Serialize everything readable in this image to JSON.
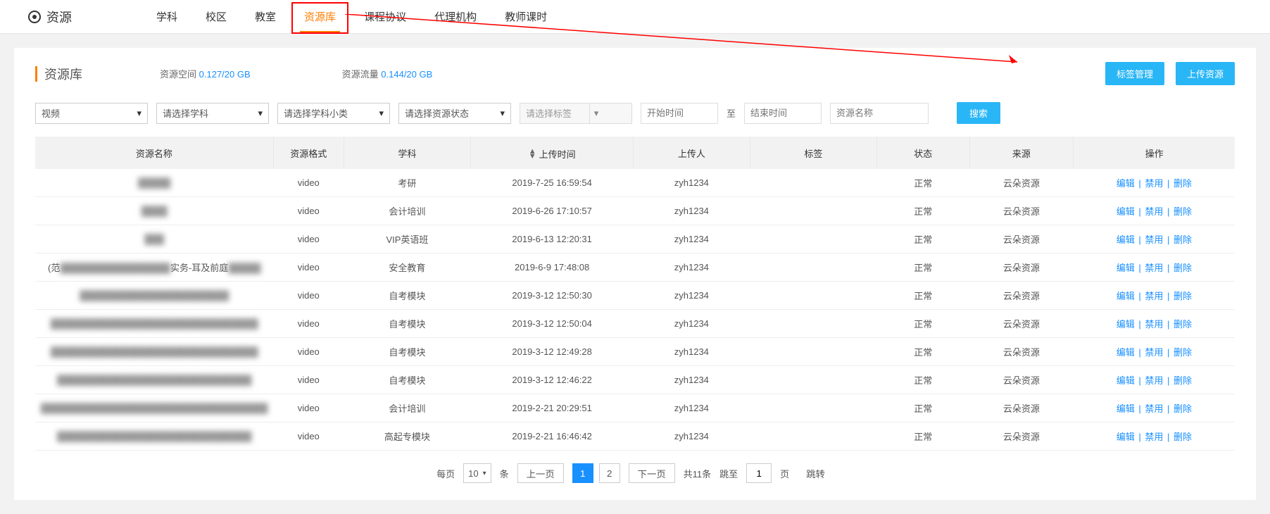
{
  "topNav": {
    "title": "资源",
    "tabs": [
      "学科",
      "校区",
      "教室",
      "资源库",
      "课程协议",
      "代理机构",
      "教师课时"
    ],
    "activeIndex": 3
  },
  "page": {
    "title": "资源库",
    "stats": {
      "spaceLabel": "资源空间",
      "spaceValue": "0.127/20 GB",
      "trafficLabel": "资源流量",
      "trafficValue": "0.144/20 GB"
    },
    "actions": {
      "tagManage": "标签管理",
      "upload": "上传资源"
    }
  },
  "filters": {
    "type": "视频",
    "subject": "请选择学科",
    "subcat": "请选择学科小类",
    "status": "请选择资源状态",
    "tag": "请选择标签",
    "startPlaceholder": "开始时间",
    "to": "至",
    "endPlaceholder": "结束时间",
    "namePlaceholder": "资源名称",
    "search": "搜索"
  },
  "table": {
    "headers": [
      "资源名称",
      "资源格式",
      "学科",
      "上传时间",
      "上传人",
      "标签",
      "状态",
      "来源",
      "操作"
    ],
    "sortCol": 3,
    "rows": [
      {
        "name": "█████",
        "blurred": true,
        "format": "video",
        "subject": "考研",
        "time": "2019-7-25 16:59:54",
        "uploader": "zyh1234",
        "tag": "",
        "status": "正常",
        "source": "云朵资源"
      },
      {
        "name": "████",
        "blurred": true,
        "format": "video",
        "subject": "会计培训",
        "time": "2019-6-26 17:10:57",
        "uploader": "zyh1234",
        "tag": "",
        "status": "正常",
        "source": "云朵资源"
      },
      {
        "name": "███",
        "blurred": true,
        "format": "video",
        "subject": "VIP英语班",
        "time": "2019-6-13 12:20:31",
        "uploader": "zyh1234",
        "tag": "",
        "status": "正常",
        "source": "云朵资源"
      },
      {
        "name": "(范█████████████████实务-耳及前庭█████",
        "blurred": false,
        "partialBlur": true,
        "format": "video",
        "subject": "安全教育",
        "time": "2019-6-9 17:48:08",
        "uploader": "zyh1234",
        "tag": "",
        "status": "正常",
        "source": "云朵资源"
      },
      {
        "name": "███████████████████████",
        "blurred": true,
        "format": "video",
        "subject": "自考模块",
        "time": "2019-3-12 12:50:30",
        "uploader": "zyh1234",
        "tag": "",
        "status": "正常",
        "source": "云朵资源"
      },
      {
        "name": "████████████████████████████████",
        "blurred": true,
        "format": "video",
        "subject": "自考模块",
        "time": "2019-3-12 12:50:04",
        "uploader": "zyh1234",
        "tag": "",
        "status": "正常",
        "source": "云朵资源"
      },
      {
        "name": "████████████████████████████████",
        "blurred": true,
        "format": "video",
        "subject": "自考模块",
        "time": "2019-3-12 12:49:28",
        "uploader": "zyh1234",
        "tag": "",
        "status": "正常",
        "source": "云朵资源"
      },
      {
        "name": "██████████████████████████████",
        "blurred": true,
        "format": "video",
        "subject": "自考模块",
        "time": "2019-3-12 12:46:22",
        "uploader": "zyh1234",
        "tag": "",
        "status": "正常",
        "source": "云朵资源"
      },
      {
        "name": "███████████████████████████████████",
        "blurred": true,
        "format": "video",
        "subject": "会计培训",
        "time": "2019-2-21 20:29:51",
        "uploader": "zyh1234",
        "tag": "",
        "status": "正常",
        "source": "云朵资源"
      },
      {
        "name": "██████████████████████████████",
        "blurred": true,
        "format": "video",
        "subject": "高起专模块",
        "time": "2019-2-21 16:46:42",
        "uploader": "zyh1234",
        "tag": "",
        "status": "正常",
        "source": "云朵资源"
      }
    ],
    "actions": {
      "edit": "编辑",
      "disable": "禁用",
      "delete": "删除"
    }
  },
  "pagination": {
    "perPageLabel": "每页",
    "perPageValue": "10",
    "perPageUnit": "条",
    "prev": "上一页",
    "pages": [
      "1",
      "2"
    ],
    "activePage": 0,
    "next": "下一页",
    "totalLabel": "共11条",
    "jumpLabel": "跳至",
    "jumpValue": "1",
    "jumpUnit": "页",
    "jumpBtn": "跳转"
  }
}
